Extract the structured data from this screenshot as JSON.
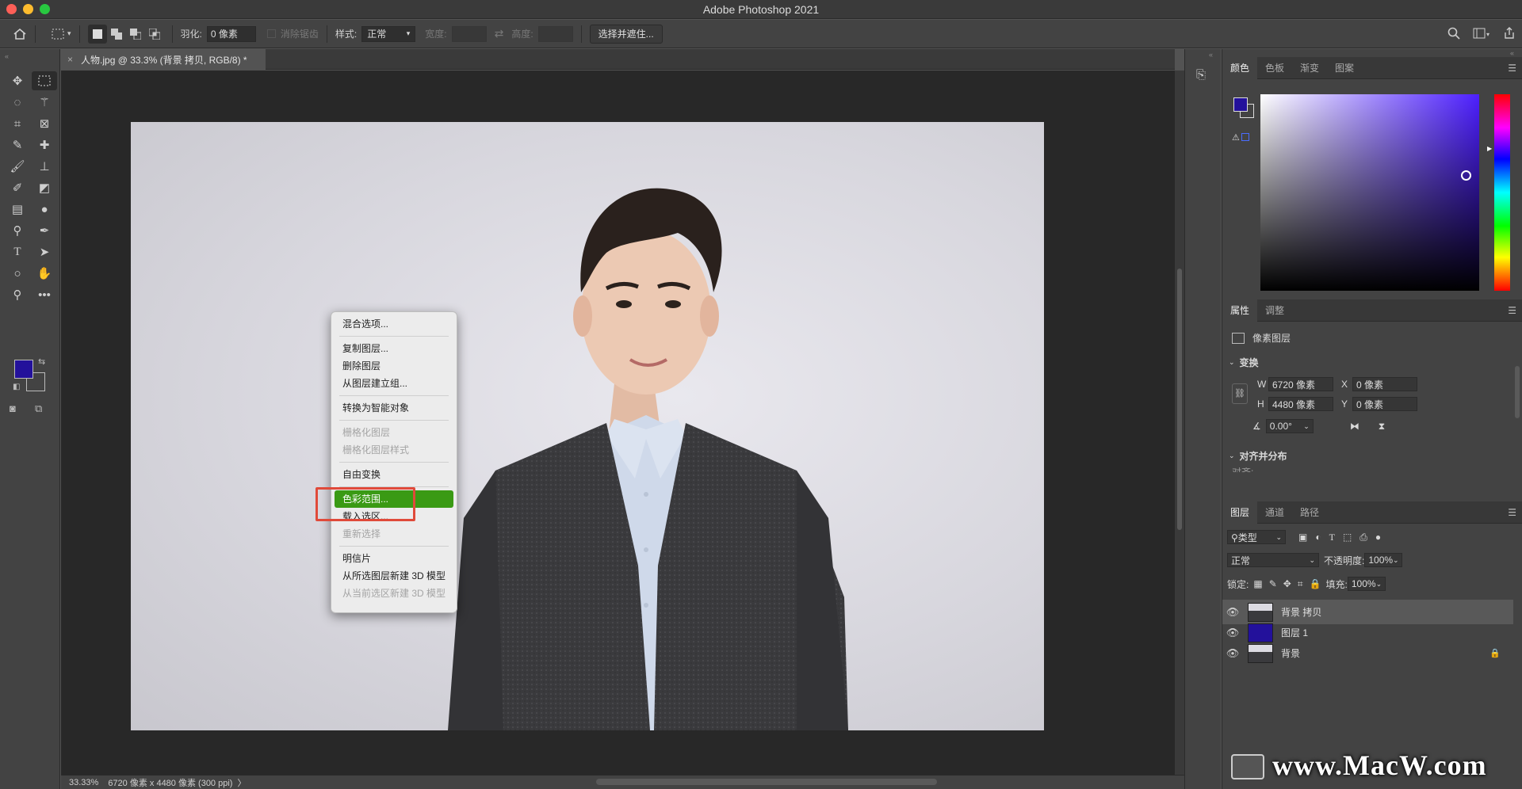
{
  "window": {
    "title": "Adobe Photoshop 2021"
  },
  "options_bar": {
    "feather_label": "羽化:",
    "feather_value": "0 像素",
    "antialias_label": "消除锯齿",
    "style_label": "样式:",
    "style_value": "正常",
    "width_label": "宽度:",
    "height_label": "高度:",
    "select_mask_button": "选择并遮住..."
  },
  "document": {
    "tab_title": "人物.jpg @ 33.3% (背景 拷贝, RGB/8) *"
  },
  "status_bar": {
    "zoom": "33.33%",
    "info": "6720 像素 x 4480 像素 (300 ppi)",
    "arrow": "〉"
  },
  "context_menu": {
    "items": [
      {
        "label": "混合选项...",
        "disabled": false
      },
      {
        "sep": true
      },
      {
        "label": "复制图层...",
        "disabled": false
      },
      {
        "label": "删除图层",
        "disabled": false
      },
      {
        "label": "从图层建立组...",
        "disabled": false
      },
      {
        "sep": true
      },
      {
        "label": "转换为智能对象",
        "disabled": false
      },
      {
        "sep": true
      },
      {
        "label": "栅格化图层",
        "disabled": true
      },
      {
        "label": "栅格化图层样式",
        "disabled": true
      },
      {
        "sep": true
      },
      {
        "label": "自由变换",
        "disabled": false
      },
      {
        "sep": true
      },
      {
        "label": "色彩范围...",
        "disabled": false,
        "selected": true
      },
      {
        "label": "载入选区...",
        "disabled": false
      },
      {
        "label": "重新选择",
        "disabled": true
      },
      {
        "sep": true
      },
      {
        "label": "明信片",
        "disabled": false
      },
      {
        "label": "从所选图层新建 3D 模型",
        "disabled": false
      },
      {
        "label": "从当前选区新建 3D 模型",
        "disabled": true
      }
    ]
  },
  "color_panel": {
    "tabs": [
      "颜色",
      "色板",
      "渐变",
      "图案"
    ],
    "foreground": "#23119b",
    "background": "#434343"
  },
  "properties_panel": {
    "tabs": [
      "属性",
      "调整"
    ],
    "layer_type": "像素图层",
    "transform_header": "变换",
    "w_label": "W",
    "w_value": "6720 像素",
    "x_label": "X",
    "x_value": "0 像素",
    "h_label": "H",
    "h_value": "4480 像素",
    "y_label": "Y",
    "y_value": "0 像素",
    "angle_value": "0.00°",
    "align_header": "对齐并分布",
    "align_sub": "对齐:"
  },
  "layers_panel": {
    "tabs": [
      "图层",
      "通道",
      "路径"
    ],
    "filter_label": "类型",
    "blend_mode": "正常",
    "opacity_label": "不透明度:",
    "opacity_value": "100%",
    "lock_label": "锁定:",
    "fill_label": "填充:",
    "fill_value": "100%",
    "layers": [
      {
        "name": "背景 拷贝",
        "selected": true,
        "thumb": "photo"
      },
      {
        "name": "图层 1",
        "selected": false,
        "thumb": "#23119b"
      },
      {
        "name": "背景",
        "selected": false,
        "thumb": "photo",
        "locked": true
      }
    ]
  },
  "watermark": "www.MacW.com"
}
